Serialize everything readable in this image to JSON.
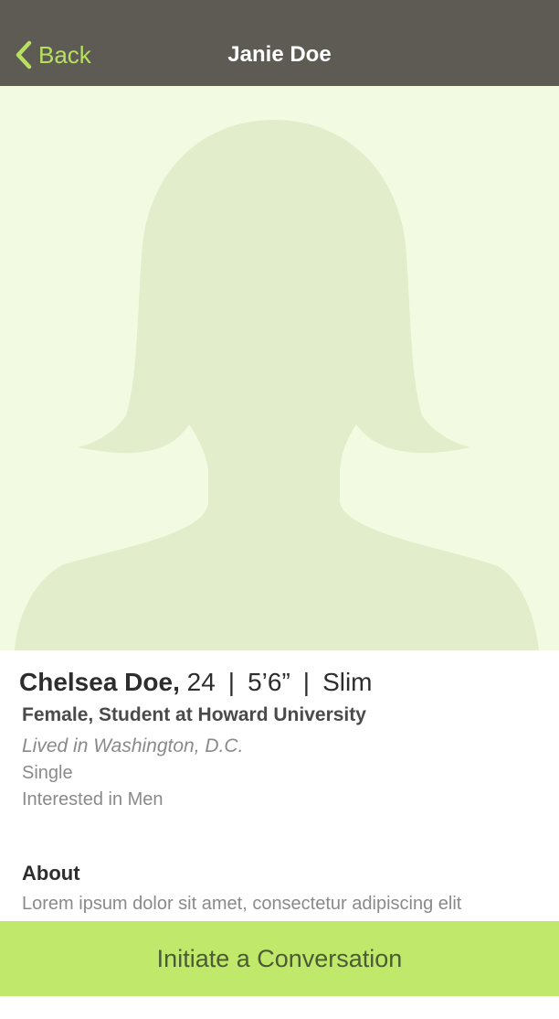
{
  "nav": {
    "back_label": "Back",
    "title": "Janie Doe"
  },
  "colors": {
    "navbar_bg": "#5e5b55",
    "accent": "#b8e060",
    "photo_bg": "#f2fbe2",
    "silhouette": "#e1edcb",
    "cta_bg": "#c0e86a"
  },
  "profile": {
    "photo_icon": "female-silhouette-placeholder",
    "name": "Chelsea Doe,",
    "age": "24",
    "separator": "|",
    "height": "5’6”",
    "build": "Slim",
    "subtitle": "Female, Student at Howard University",
    "location": "Lived in Washington, D.C.",
    "relationship_status": "Single",
    "interested_in": "Interested in Men",
    "about_heading": "About",
    "about_text": "Lorem ipsum dolor sit amet, consectetur adipiscing elit"
  },
  "actions": {
    "initiate_label": "Initiate a Conversation"
  }
}
